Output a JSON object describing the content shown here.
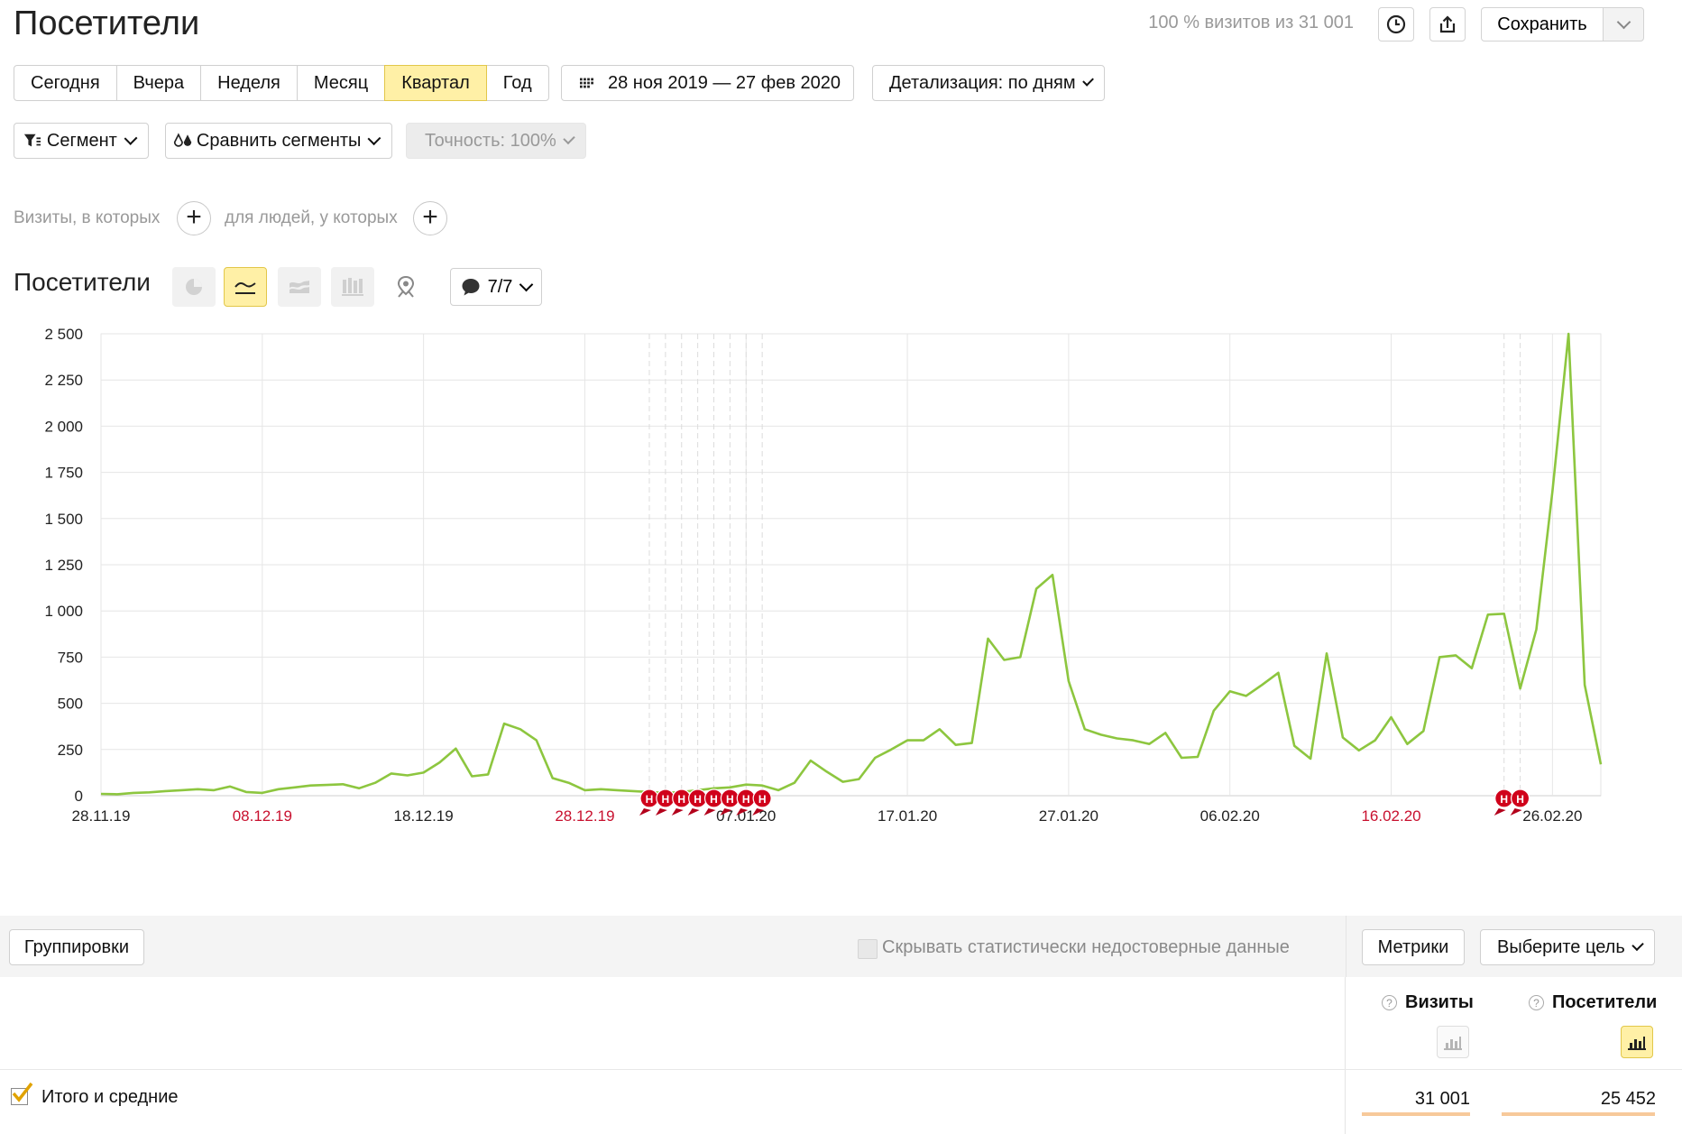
{
  "header": {
    "title": "Посетители",
    "visits_info": "100 % визитов из 31 001",
    "save_label": "Сохранить"
  },
  "periods": [
    {
      "label": "Сегодня",
      "active": false
    },
    {
      "label": "Вчера",
      "active": false
    },
    {
      "label": "Неделя",
      "active": false
    },
    {
      "label": "Месяц",
      "active": false
    },
    {
      "label": "Квартал",
      "active": true
    },
    {
      "label": "Год",
      "active": false
    }
  ],
  "date_range": "28 ноя 2019 — 27 фев 2020",
  "detail": "Детализация: по дням",
  "filters": {
    "segment": "Сегмент",
    "compare": "Сравнить сегменты",
    "accuracy": "Точность: 100%"
  },
  "conditions": {
    "visits_label": "Визиты, в которых",
    "people_label": "для людей, у которых"
  },
  "chart_section": {
    "title": "Посетители",
    "notes_count": "7/7"
  },
  "chart_data": {
    "type": "line",
    "ylim": [
      0,
      2500
    ],
    "y_ticks": [
      {
        "v": 0,
        "label": "0"
      },
      {
        "v": 250,
        "label": "250"
      },
      {
        "v": 500,
        "label": "500"
      },
      {
        "v": 750,
        "label": "750"
      },
      {
        "v": 1000,
        "label": "1 000"
      },
      {
        "v": 1250,
        "label": "1 250"
      },
      {
        "v": 1500,
        "label": "1 500"
      },
      {
        "v": 1750,
        "label": "1 750"
      },
      {
        "v": 2000,
        "label": "2 000"
      },
      {
        "v": 2250,
        "label": "2 250"
      },
      {
        "v": 2500,
        "label": "2 500"
      }
    ],
    "x_ticks": [
      {
        "i": 0,
        "label": "28.11.19",
        "weekend": false
      },
      {
        "i": 10,
        "label": "08.12.19",
        "weekend": true
      },
      {
        "i": 20,
        "label": "18.12.19",
        "weekend": false
      },
      {
        "i": 30,
        "label": "28.12.19",
        "weekend": true
      },
      {
        "i": 40,
        "label": "07.01.20",
        "weekend": false
      },
      {
        "i": 50,
        "label": "17.01.20",
        "weekend": false
      },
      {
        "i": 60,
        "label": "27.01.20",
        "weekend": false
      },
      {
        "i": 70,
        "label": "06.02.20",
        "weekend": false
      },
      {
        "i": 80,
        "label": "16.02.20",
        "weekend": true
      },
      {
        "i": 90,
        "label": "26.02.20",
        "weekend": false
      }
    ],
    "holiday_marker_label": "Н",
    "holidays": [
      34,
      35,
      36,
      37,
      38,
      39,
      40,
      41
    ],
    "holidays_late": [
      87,
      88
    ],
    "values": [
      10,
      8,
      15,
      18,
      25,
      30,
      35,
      30,
      50,
      20,
      15,
      35,
      45,
      55,
      58,
      62,
      40,
      70,
      120,
      110,
      125,
      180,
      255,
      105,
      115,
      390,
      360,
      300,
      95,
      70,
      30,
      35,
      30,
      25,
      20,
      15,
      20,
      30,
      40,
      45,
      60,
      55,
      30,
      70,
      190,
      130,
      75,
      90,
      205,
      250,
      300,
      300,
      360,
      275,
      285,
      850,
      735,
      750,
      1120,
      1195,
      620,
      360,
      330,
      310,
      300,
      280,
      340,
      205,
      210,
      460,
      565,
      540,
      600,
      665,
      270,
      200,
      770,
      315,
      245,
      300,
      425,
      280,
      350,
      750,
      760,
      690,
      980,
      985,
      580,
      900,
      1650,
      2500,
      600,
      170
    ],
    "line_color": "#8dc63f"
  },
  "table_toolbar": {
    "groupings": "Группировки",
    "hide_unreliable": "Скрывать статистически недостоверные данные",
    "metrics": "Метрики",
    "goal": "Выберите цель"
  },
  "table": {
    "columns": [
      {
        "label": "Визиты",
        "help": "?"
      },
      {
        "label": "Посетители",
        "help": "?"
      }
    ],
    "totals_label": "Итого и средние",
    "totals": [
      "31 001",
      "25 452"
    ]
  }
}
